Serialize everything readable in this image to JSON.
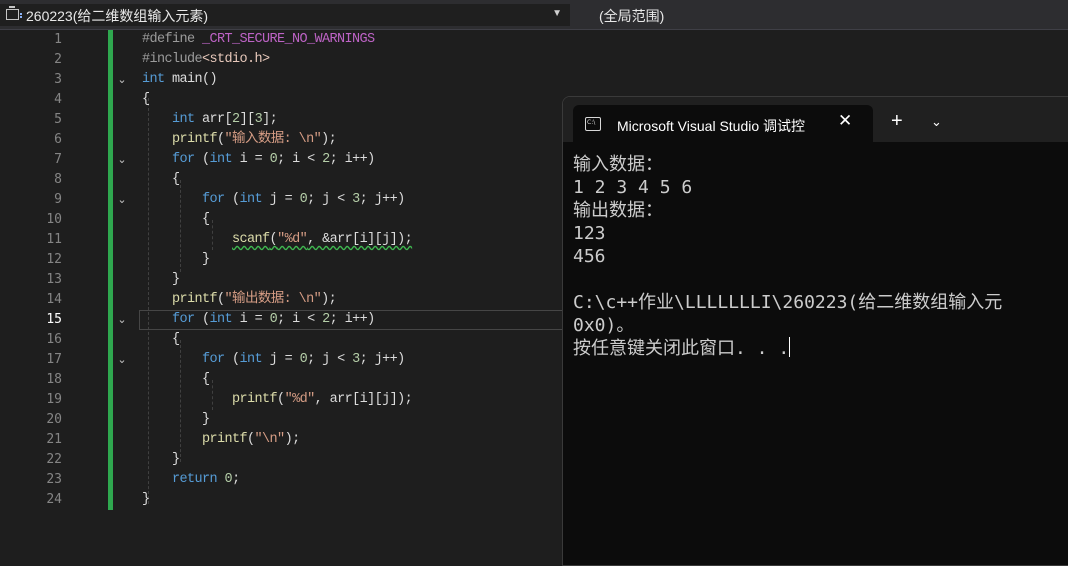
{
  "navbar": {
    "project": "260223(给二维数组输入元素)",
    "scope": "(全局范围)"
  },
  "editor": {
    "active_line": 15,
    "line_numbers": [
      "1",
      "2",
      "3",
      "4",
      "5",
      "6",
      "7",
      "8",
      "9",
      "10",
      "11",
      "12",
      "13",
      "14",
      "15",
      "16",
      "17",
      "18",
      "19",
      "20",
      "21",
      "22",
      "23",
      "24"
    ],
    "lines": [
      "#define _CRT_SECURE_NO_WARNINGS",
      "#include<stdio.h>",
      "int main()",
      "{",
      "    int arr[2][3];",
      "    printf(\"输入数据: \\n\");",
      "    for (int i = 0; i < 2; i++)",
      "    {",
      "        for (int j = 0; j < 3; j++)",
      "        {",
      "            scanf(\"%d\", &arr[i][j]);",
      "        }",
      "    }",
      "    printf(\"输出数据: \\n\");",
      "    for (int i = 0; i < 2; i++)",
      "    {",
      "        for (int j = 0; j < 3; j++)",
      "        {",
      "            printf(\"%d\", arr[i][j]);",
      "        }",
      "        printf(\"\\n\");",
      "    }",
      "    return 0;",
      "}"
    ]
  },
  "console": {
    "tab_title": "Microsoft Visual Studio 调试控",
    "close_icon": "close-icon",
    "new_tab_icon": "plus-icon",
    "dropdown_icon": "chevron-down-icon",
    "output": [
      "输入数据：",
      "1 2 3 4 5 6",
      "输出数据：",
      "123",
      "456",
      "",
      "C:\\c++作业\\LLLLLLLI\\260223(给二维数组输入元",
      "0x0)。",
      "按任意键关闭此窗口. . ."
    ]
  }
}
